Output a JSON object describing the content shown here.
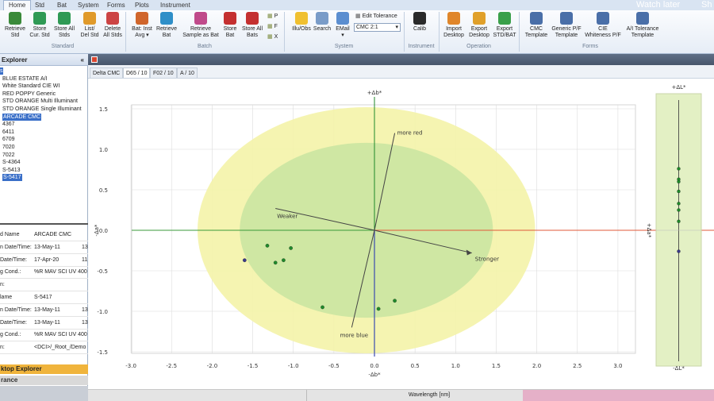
{
  "ribbon_tabs": [
    "Home",
    "Std",
    "Bat",
    "System",
    "Forms",
    "Plots",
    "Instrument"
  ],
  "overlay": {
    "watch_later": "Watch later",
    "share": "Sh"
  },
  "ribbon": {
    "buttons": [
      {
        "label": "Retrieve\nStd",
        "icon": "retrieve-std-icon",
        "color": "#3a8a3a"
      },
      {
        "label": "Store\nCur. Std",
        "icon": "store-disk-icon",
        "color": "#2f9a55"
      },
      {
        "label": "Store All\nStds",
        "icon": "store-all-disk-icon",
        "color": "#2f9a55"
      },
      {
        "label": "List/\nDel Std",
        "icon": "list-del-icon",
        "color": "#e09a2a"
      },
      {
        "label": "Delete\nAll Stds",
        "icon": "delete-all-icon",
        "color": "#cc4444"
      },
      {
        "label": "Bat: Inst\nAvg ▾",
        "icon": "bat-inst-icon",
        "color": "#d0662c"
      },
      {
        "label": "Retrieve\nBat",
        "icon": "retrieve-bat-icon",
        "color": "#2f8fc8"
      },
      {
        "label": "Retrieve\nSample as Bat",
        "icon": "retrieve-sample-icon",
        "color": "#c04a8a"
      },
      {
        "label": "Store\nBat",
        "icon": "store-bat-icon",
        "color": "#c43030"
      },
      {
        "label": "Store All\nBats",
        "icon": "store-all-bats-icon",
        "color": "#c43030"
      },
      {
        "label": "Illu/Obs",
        "icon": "bulb-icon",
        "color": "#f0c030"
      },
      {
        "label": "Search",
        "icon": "search-icon",
        "color": "#7a9cc8"
      },
      {
        "label": "EMail\n▾",
        "icon": "email-icon",
        "color": "#5b8ed0"
      },
      {
        "label": "Calib",
        "icon": "calib-icon",
        "color": "#2a2a2a"
      },
      {
        "label": "Import\nDesktop",
        "icon": "import-desktop-icon",
        "color": "#e0862a"
      },
      {
        "label": "Export\nDesktop",
        "icon": "export-desktop-icon",
        "color": "#e0a02a"
      },
      {
        "label": "Export\nSTD/BAT",
        "icon": "export-std-bat-icon",
        "color": "#3aa04a"
      },
      {
        "label": "CMC\nTemplate",
        "icon": "cmc-template-icon",
        "color": "#4a6fa8"
      },
      {
        "label": "Generic P/F\nTemplate",
        "icon": "generic-pf-icon",
        "color": "#4a6fa8"
      },
      {
        "label": "CIE\nWhiteness P/F",
        "icon": "cie-whiteness-icon",
        "color": "#4a6fa8"
      },
      {
        "label": "A/I Tolerance\nTemplate",
        "icon": "ai-tolerance-icon",
        "color": "#4a6fa8"
      }
    ],
    "small_pfx": [
      "P",
      "F",
      "X"
    ],
    "edit_tolerance": "Edit Tolerance",
    "cmc_combo": "CMC 2:1",
    "groups": [
      "Standard",
      "Batch",
      "System",
      "Instrument",
      "Operation",
      "Forms"
    ]
  },
  "explorer": {
    "title": "Explorer",
    "collapse_glyph": "«",
    "items": [
      {
        "label": "s",
        "selected": true
      },
      {
        "label": "BLUE ESTATE A/I",
        "selected": false
      },
      {
        "label": "White Standard CIE WI",
        "selected": false
      },
      {
        "label": "RED POPPY Generic",
        "selected": false
      },
      {
        "label": "STD ORANGE Multi Illuminant",
        "selected": false
      },
      {
        "label": "STD ORANGE Single Illuminant",
        "selected": false
      },
      {
        "label": "ARCADE CMC",
        "selected": true
      },
      {
        "label": "4367",
        "selected": false
      },
      {
        "label": "6411",
        "selected": false
      },
      {
        "label": "6709",
        "selected": false
      },
      {
        "label": "7020",
        "selected": false
      },
      {
        "label": "7022",
        "selected": false
      },
      {
        "label": "S-4364",
        "selected": false
      },
      {
        "label": "S-5413",
        "selected": false
      },
      {
        "label": "S-5417",
        "selected": true
      }
    ],
    "properties": [
      {
        "name": "d Name",
        "value": "ARCADE CMC",
        "extra": ""
      },
      {
        "name": "n Date/Time:",
        "value": "13-May-11",
        "extra": "13"
      },
      {
        "name": "Date/Time:",
        "value": "17-Apr-20",
        "extra": "11"
      },
      {
        "name": "g Cond.:",
        "value": "%R MAV  SCI UV 400",
        "extra": ""
      },
      {
        "name": "n:",
        "value": "",
        "extra": ""
      },
      {
        "name": "lame",
        "value": "S-5417",
        "extra": ""
      },
      {
        "name": "n Date/Time:",
        "value": "13-May-11",
        "extra": "13"
      },
      {
        "name": "Date/Time:",
        "value": "13-May-11",
        "extra": "13"
      },
      {
        "name": "g Cond.:",
        "value": "%R MAV  SCI UV 400",
        "extra": ""
      },
      {
        "name": "n:",
        "value": "<DCI>/_Root_/Demo",
        "extra": ""
      }
    ],
    "bottom_tabs": [
      "ktop Explorer",
      "rance"
    ]
  },
  "doc": {
    "tabs": [
      "Delta CMC",
      "D65 / 10",
      "F02 / 10",
      "A / 10"
    ],
    "active_tab": 1
  },
  "chart_data": [
    {
      "type": "scatter",
      "title": "",
      "xlabel": "-Δb*",
      "top_label": "+Δb*",
      "ylabel_left": "-Δa*",
      "ylabel_right": "+Δa*",
      "xlim": [
        -3.0,
        3.0
      ],
      "ylim": [
        -1.5,
        1.5
      ],
      "x_ticks": [
        "-3.0",
        "-2.5",
        "-2.0",
        "-1.5",
        "-1.0",
        "-0.5",
        "0.0",
        "0.5",
        "1.0",
        "1.5",
        "2.0",
        "2.5",
        "3.0"
      ],
      "y_ticks": [
        "1.5",
        "1.0",
        "0.5",
        "0.0",
        "-0.5",
        "-1.0",
        "-1.5"
      ],
      "grid": true,
      "ellipses": [
        {
          "name": "outer",
          "center": [
            -0.1,
            0.0
          ],
          "radii": [
            2.08,
            1.52
          ],
          "color": "#f4f3a9"
        },
        {
          "name": "inner",
          "center": [
            -0.1,
            0.0
          ],
          "radii": [
            1.56,
            1.08
          ],
          "color": "#cbe5a2"
        }
      ],
      "vectors": [
        {
          "label": "more red",
          "from": [
            0.0,
            0.0
          ],
          "to": [
            0.25,
            1.2
          ]
        },
        {
          "label": "more blue",
          "from": [
            0.0,
            0.0
          ],
          "to": [
            -0.28,
            -1.2
          ]
        },
        {
          "label": "Weaker",
          "from": [
            0.0,
            0.0
          ],
          "to": [
            -1.22,
            0.27
          ]
        },
        {
          "label": "Stronger",
          "from": [
            0.0,
            0.0
          ],
          "to": [
            1.2,
            -0.28
          ]
        }
      ],
      "points": [
        {
          "x": -1.6,
          "y": -0.37,
          "color": "#3a3a8a"
        },
        {
          "x": -1.32,
          "y": -0.19,
          "color": "#1f8a2a"
        },
        {
          "x": -1.22,
          "y": -0.4,
          "color": "#1f8a2a"
        },
        {
          "x": -1.12,
          "y": -0.37,
          "color": "#1f8a2a"
        },
        {
          "x": -1.03,
          "y": -0.22,
          "color": "#1f8a2a"
        },
        {
          "x": -0.64,
          "y": -0.95,
          "color": "#1f8a2a"
        },
        {
          "x": 0.05,
          "y": -0.97,
          "color": "#1f8a2a"
        },
        {
          "x": 0.25,
          "y": -0.87,
          "color": "#1f8a2a"
        }
      ],
      "axis_colors": {
        "positive_a": "#e05a3a",
        "negative_a": "#3a9a3a",
        "positive_b": "#1f8a2a",
        "negative_b": "#3a4ab0"
      }
    },
    {
      "type": "scatter",
      "title": "",
      "top_label": "+ΔL*",
      "bottom_label": "-ΔL*",
      "ylim": [
        -1.5,
        1.5
      ],
      "points": [
        {
          "y": 0.76,
          "color": "#1f8a2a"
        },
        {
          "y": 0.63,
          "color": "#1f8a2a"
        },
        {
          "y": 0.6,
          "color": "#1f8a2a"
        },
        {
          "y": 0.48,
          "color": "#1f8a2a"
        },
        {
          "y": 0.33,
          "color": "#1f8a2a"
        },
        {
          "y": 0.25,
          "color": "#1f8a2a"
        },
        {
          "y": 0.11,
          "color": "#1f8a2a"
        },
        {
          "y": -0.26,
          "color": "#3a3a8a"
        }
      ],
      "background": "#e3f0c4"
    }
  ],
  "status": {
    "wavelength_label": "Wavelength [nm]"
  }
}
